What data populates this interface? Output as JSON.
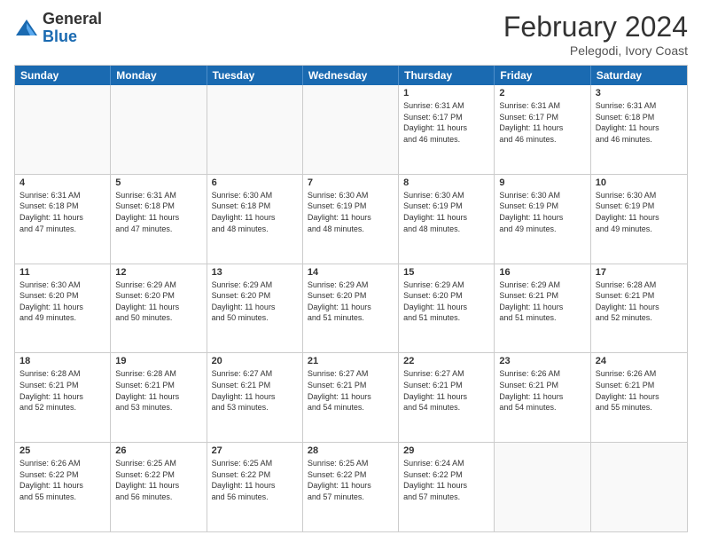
{
  "logo": {
    "general": "General",
    "blue": "Blue"
  },
  "header": {
    "month": "February 2024",
    "location": "Pelegodi, Ivory Coast"
  },
  "weekdays": [
    "Sunday",
    "Monday",
    "Tuesday",
    "Wednesday",
    "Thursday",
    "Friday",
    "Saturday"
  ],
  "weeks": [
    [
      {
        "day": "",
        "info": ""
      },
      {
        "day": "",
        "info": ""
      },
      {
        "day": "",
        "info": ""
      },
      {
        "day": "",
        "info": ""
      },
      {
        "day": "1",
        "info": "Sunrise: 6:31 AM\nSunset: 6:17 PM\nDaylight: 11 hours\nand 46 minutes."
      },
      {
        "day": "2",
        "info": "Sunrise: 6:31 AM\nSunset: 6:17 PM\nDaylight: 11 hours\nand 46 minutes."
      },
      {
        "day": "3",
        "info": "Sunrise: 6:31 AM\nSunset: 6:18 PM\nDaylight: 11 hours\nand 46 minutes."
      }
    ],
    [
      {
        "day": "4",
        "info": "Sunrise: 6:31 AM\nSunset: 6:18 PM\nDaylight: 11 hours\nand 47 minutes."
      },
      {
        "day": "5",
        "info": "Sunrise: 6:31 AM\nSunset: 6:18 PM\nDaylight: 11 hours\nand 47 minutes."
      },
      {
        "day": "6",
        "info": "Sunrise: 6:30 AM\nSunset: 6:18 PM\nDaylight: 11 hours\nand 48 minutes."
      },
      {
        "day": "7",
        "info": "Sunrise: 6:30 AM\nSunset: 6:19 PM\nDaylight: 11 hours\nand 48 minutes."
      },
      {
        "day": "8",
        "info": "Sunrise: 6:30 AM\nSunset: 6:19 PM\nDaylight: 11 hours\nand 48 minutes."
      },
      {
        "day": "9",
        "info": "Sunrise: 6:30 AM\nSunset: 6:19 PM\nDaylight: 11 hours\nand 49 minutes."
      },
      {
        "day": "10",
        "info": "Sunrise: 6:30 AM\nSunset: 6:19 PM\nDaylight: 11 hours\nand 49 minutes."
      }
    ],
    [
      {
        "day": "11",
        "info": "Sunrise: 6:30 AM\nSunset: 6:20 PM\nDaylight: 11 hours\nand 49 minutes."
      },
      {
        "day": "12",
        "info": "Sunrise: 6:29 AM\nSunset: 6:20 PM\nDaylight: 11 hours\nand 50 minutes."
      },
      {
        "day": "13",
        "info": "Sunrise: 6:29 AM\nSunset: 6:20 PM\nDaylight: 11 hours\nand 50 minutes."
      },
      {
        "day": "14",
        "info": "Sunrise: 6:29 AM\nSunset: 6:20 PM\nDaylight: 11 hours\nand 51 minutes."
      },
      {
        "day": "15",
        "info": "Sunrise: 6:29 AM\nSunset: 6:20 PM\nDaylight: 11 hours\nand 51 minutes."
      },
      {
        "day": "16",
        "info": "Sunrise: 6:29 AM\nSunset: 6:21 PM\nDaylight: 11 hours\nand 51 minutes."
      },
      {
        "day": "17",
        "info": "Sunrise: 6:28 AM\nSunset: 6:21 PM\nDaylight: 11 hours\nand 52 minutes."
      }
    ],
    [
      {
        "day": "18",
        "info": "Sunrise: 6:28 AM\nSunset: 6:21 PM\nDaylight: 11 hours\nand 52 minutes."
      },
      {
        "day": "19",
        "info": "Sunrise: 6:28 AM\nSunset: 6:21 PM\nDaylight: 11 hours\nand 53 minutes."
      },
      {
        "day": "20",
        "info": "Sunrise: 6:27 AM\nSunset: 6:21 PM\nDaylight: 11 hours\nand 53 minutes."
      },
      {
        "day": "21",
        "info": "Sunrise: 6:27 AM\nSunset: 6:21 PM\nDaylight: 11 hours\nand 54 minutes."
      },
      {
        "day": "22",
        "info": "Sunrise: 6:27 AM\nSunset: 6:21 PM\nDaylight: 11 hours\nand 54 minutes."
      },
      {
        "day": "23",
        "info": "Sunrise: 6:26 AM\nSunset: 6:21 PM\nDaylight: 11 hours\nand 54 minutes."
      },
      {
        "day": "24",
        "info": "Sunrise: 6:26 AM\nSunset: 6:21 PM\nDaylight: 11 hours\nand 55 minutes."
      }
    ],
    [
      {
        "day": "25",
        "info": "Sunrise: 6:26 AM\nSunset: 6:22 PM\nDaylight: 11 hours\nand 55 minutes."
      },
      {
        "day": "26",
        "info": "Sunrise: 6:25 AM\nSunset: 6:22 PM\nDaylight: 11 hours\nand 56 minutes."
      },
      {
        "day": "27",
        "info": "Sunrise: 6:25 AM\nSunset: 6:22 PM\nDaylight: 11 hours\nand 56 minutes."
      },
      {
        "day": "28",
        "info": "Sunrise: 6:25 AM\nSunset: 6:22 PM\nDaylight: 11 hours\nand 57 minutes."
      },
      {
        "day": "29",
        "info": "Sunrise: 6:24 AM\nSunset: 6:22 PM\nDaylight: 11 hours\nand 57 minutes."
      },
      {
        "day": "",
        "info": ""
      },
      {
        "day": "",
        "info": ""
      }
    ]
  ]
}
